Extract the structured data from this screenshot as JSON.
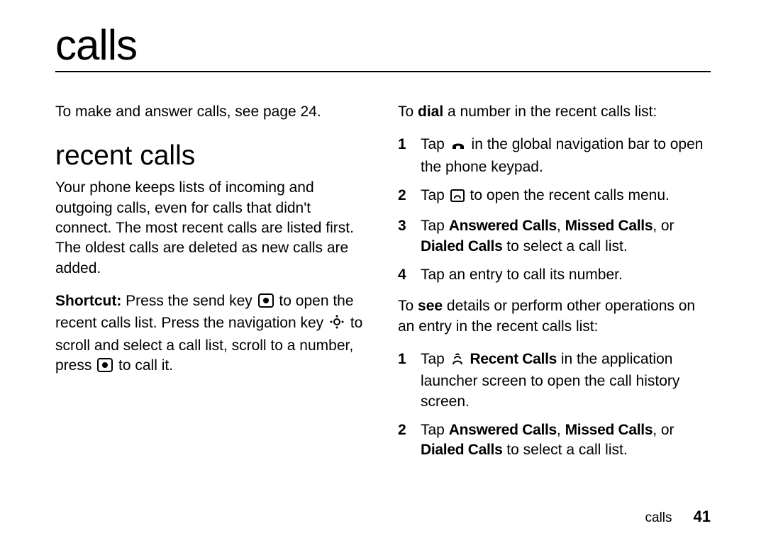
{
  "title": "calls",
  "left": {
    "intro": "To make and answer calls, see page 24.",
    "h2": "recent calls",
    "p1": "Your phone keeps lists of incoming and outgoing calls, even for calls that didn't connect. The most recent calls are listed first. The oldest calls are deleted as new calls are added.",
    "shortcut_label": "Shortcut:",
    "shortcut_a": " Press the send key ",
    "shortcut_b": " to open the recent calls list. Press the navigation key ",
    "shortcut_c": " to scroll and select a call list, scroll to a number, press ",
    "shortcut_d": " to call it."
  },
  "right": {
    "dial_a": "To ",
    "dial_bold": "dial",
    "dial_b": " a number in the recent calls list:",
    "step1_a": "Tap ",
    "step1_b": " in the global navigation bar to open the phone keypad.",
    "step2_a": "Tap ",
    "step2_b": " to open the recent calls menu.",
    "step3_a": "Tap ",
    "step3_ans": "Answered Calls",
    "step3_c1": ", ",
    "step3_missed": "Missed Calls",
    "step3_c2": ", or ",
    "step3_dialed": "Dialed Calls",
    "step3_b": " to select a call list.",
    "step4": "Tap an entry to call its number.",
    "see_a": "To ",
    "see_bold": "see",
    "see_b": " details or perform other operations on an entry in the recent calls list:",
    "s2_1_a": "Tap ",
    "s2_1_label": "Recent Calls",
    "s2_1_b": " in the application launcher screen to open the call history screen.",
    "s2_2_a": "Tap ",
    "s2_2_b": " to select a call list."
  },
  "footer": {
    "section": "calls",
    "page": "41"
  },
  "nums": {
    "n1": "1",
    "n2": "2",
    "n3": "3",
    "n4": "4"
  }
}
